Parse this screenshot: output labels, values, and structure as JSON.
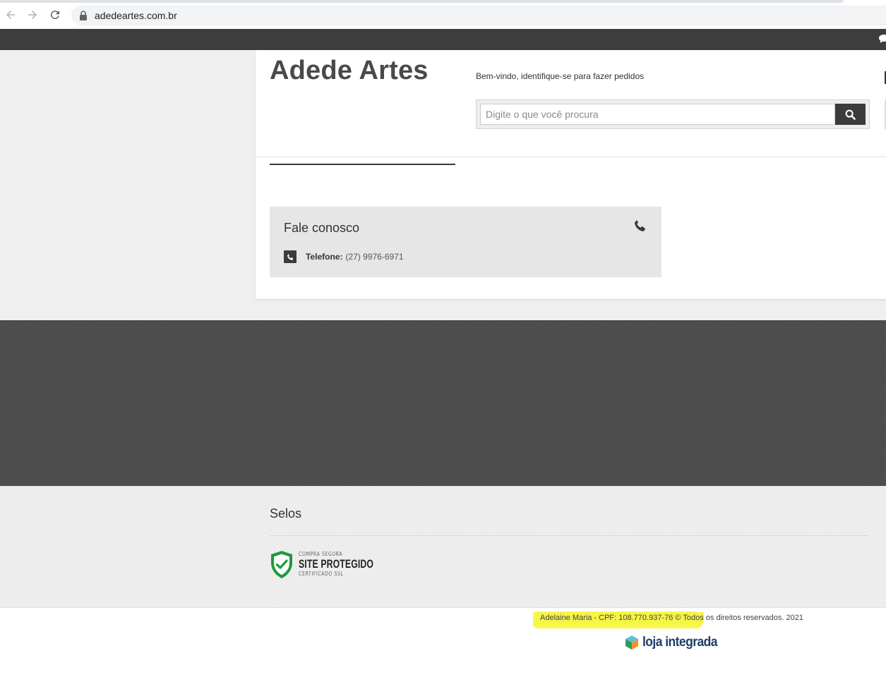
{
  "browser": {
    "url": "adedeartes.com.br",
    "icons": [
      "back-arrow-icon",
      "forward-arrow-icon",
      "reload-icon",
      "lock-icon"
    ]
  },
  "header": {
    "logo": "Adede Artes",
    "welcome": "Bem-vindo, identifique-se para fazer pedidos",
    "search": {
      "placeholder": "Digite o que você procura",
      "value": ""
    }
  },
  "contact": {
    "title": "Fale conosco",
    "phone_label": "Telefone:",
    "phone_value": "(27) 9976-6971"
  },
  "seals": {
    "title": "Selos",
    "badge": {
      "line1": "COMPRA SEGURA",
      "line2": "SITE PROTEGIDO",
      "line3": "CERTIFICADO SSL"
    }
  },
  "footer": {
    "copyright_highlighted": "Adelaine Maria - CPF: 108.770.937-76 © Todos",
    "copyright_rest": " os direitos reservados. 2021",
    "platform": "loja integrada"
  },
  "colors": {
    "topbar": "#3d3d3d",
    "dark_band": "#4b4b4b",
    "highlight": "#f5f545",
    "seal_green": "#1e9a3c",
    "loja_blue": "#1d3d66"
  }
}
